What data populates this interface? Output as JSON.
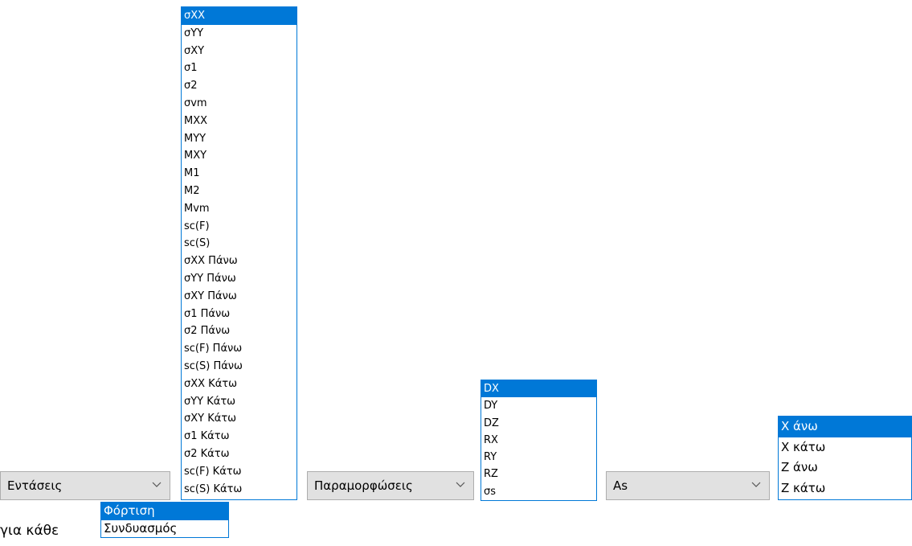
{
  "stress_combo": {
    "value": "Εντάσεις"
  },
  "stress_list": {
    "items": [
      "σXX",
      "σYY",
      "σXY",
      "σ1",
      "σ2",
      "σvm",
      "MXX",
      "MYY",
      "MXY",
      "M1",
      "M2",
      "Mvm",
      "sc(F)",
      "sc(S)",
      "σXX Πάνω",
      "σYY Πάνω",
      "σXY Πάνω",
      "σ1 Πάνω",
      "σ2 Πάνω",
      "sc(F) Πάνω",
      "sc(S) Πάνω",
      "σXX Κάτω",
      "σYY Κάτω",
      "σXY Κάτω",
      "σ1 Κάτω",
      "σ2 Κάτω",
      "sc(F) Κάτω",
      "sc(S) Κάτω"
    ],
    "selected": "σXX"
  },
  "load_list": {
    "items": [
      "Φόρτιση",
      "Συνδυασμός"
    ],
    "selected": "Φόρτιση"
  },
  "for_each_label": "για κάθε",
  "deform_combo": {
    "value": "Παραμορφώσεις"
  },
  "deform_list": {
    "items": [
      "DX",
      "DY",
      "DZ",
      "RX",
      "RY",
      "RZ",
      "σs"
    ],
    "selected": "DX"
  },
  "as_combo": {
    "value": "As"
  },
  "as_list": {
    "items": [
      "X άνω",
      "X κάτω",
      "Z άνω",
      "Z κάτω"
    ],
    "selected": "X άνω"
  },
  "icons": {
    "dropdown": "chevron-down-icon"
  },
  "colors": {
    "selection": "#0078d7",
    "combo_bg": "#e1e1e1",
    "combo_border": "#adadad"
  }
}
